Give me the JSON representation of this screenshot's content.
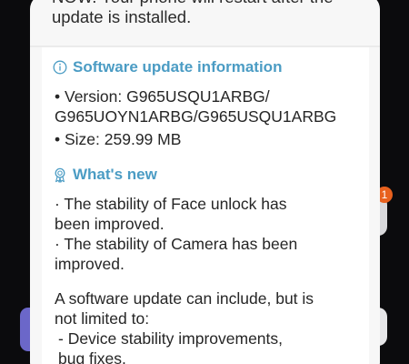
{
  "dialog": {
    "restart_note_line1": "NOW. Your phone will restart after the",
    "restart_note_line2": "update is installed."
  },
  "info_section": {
    "title": "Software update information",
    "version_line1": "• Version: G965USQU1ARBG/",
    "version_line2": "G965UOYN1ARBG/G965USQU1ARBG",
    "size": "• Size: 259.99 MB"
  },
  "whats_new": {
    "title": "What's new",
    "item1_line1": "· The stability of Face unlock has",
    "item1_line2": "been improved.",
    "item2_line1": "· The stability of Camera has been",
    "item2_line2": "improved.",
    "note_line1": "A software update can include, but is",
    "note_line2": "not limited to:",
    "note_line3": " - Device stability improvements,",
    "note_line4": "bug fixes."
  },
  "background": {
    "badge_count": "1"
  },
  "colors": {
    "accent": "#4b9cc4",
    "badge": "#e8611e",
    "sheet": "#f7f7f7",
    "card": "#ffffff"
  }
}
